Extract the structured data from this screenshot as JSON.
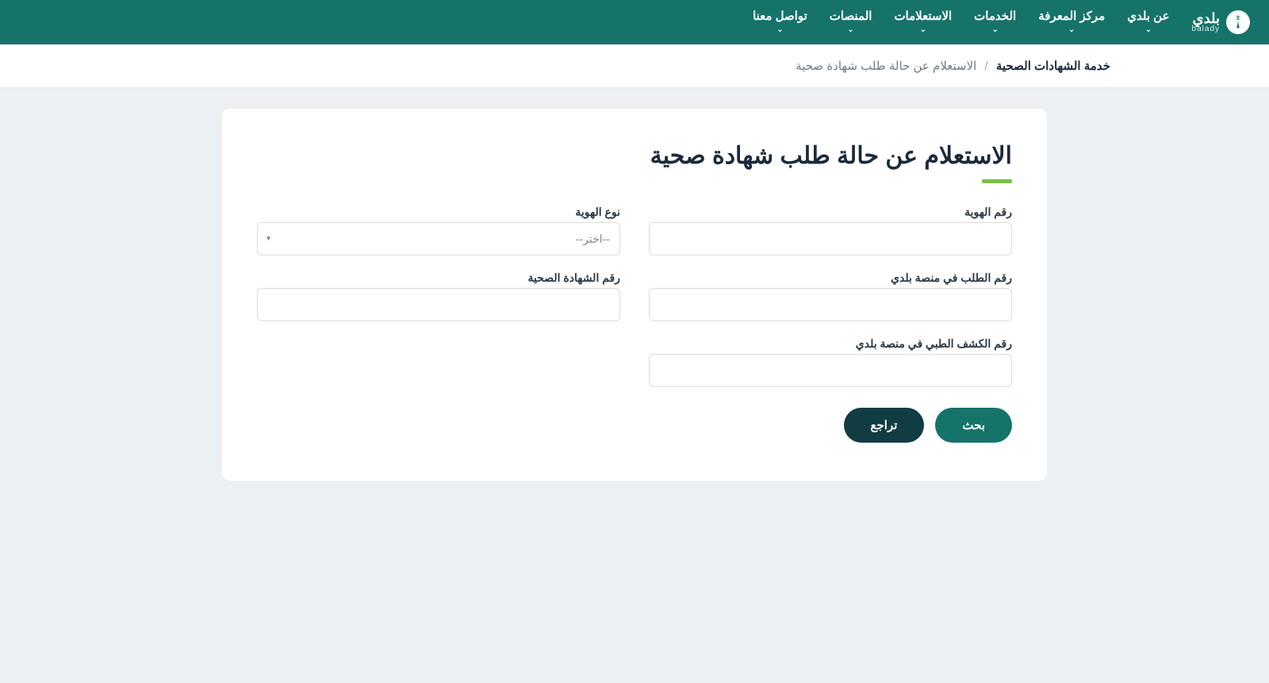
{
  "brand": {
    "ar": "بلدي",
    "en": "balady"
  },
  "nav": {
    "about": "عن بلدي",
    "knowledge": "مركز المعرفة",
    "services": "الخدمات",
    "inquiries": "الاستعلامات",
    "platforms": "المنصات",
    "contact": "تواصل معنا"
  },
  "breadcrumb": {
    "root": "خدمة الشهادات الصحية",
    "sep": "/",
    "current": "الاستعلام عن حالة طلب شهادة صحية"
  },
  "page": {
    "title": "الاستعلام عن حالة طلب شهادة صحية"
  },
  "form": {
    "id_number_label": "رقم الهوية",
    "id_type_label": "نوع الهوية",
    "id_type_placeholder": "--اختر--",
    "balady_request_label": "رقم الطلب في منصة بلدي",
    "health_cert_label": "رقم الشهادة الصحية",
    "medical_exam_label": "رقم الكشف الطبي في منصة بلدي"
  },
  "buttons": {
    "search": "بحث",
    "back": "تراجع"
  }
}
